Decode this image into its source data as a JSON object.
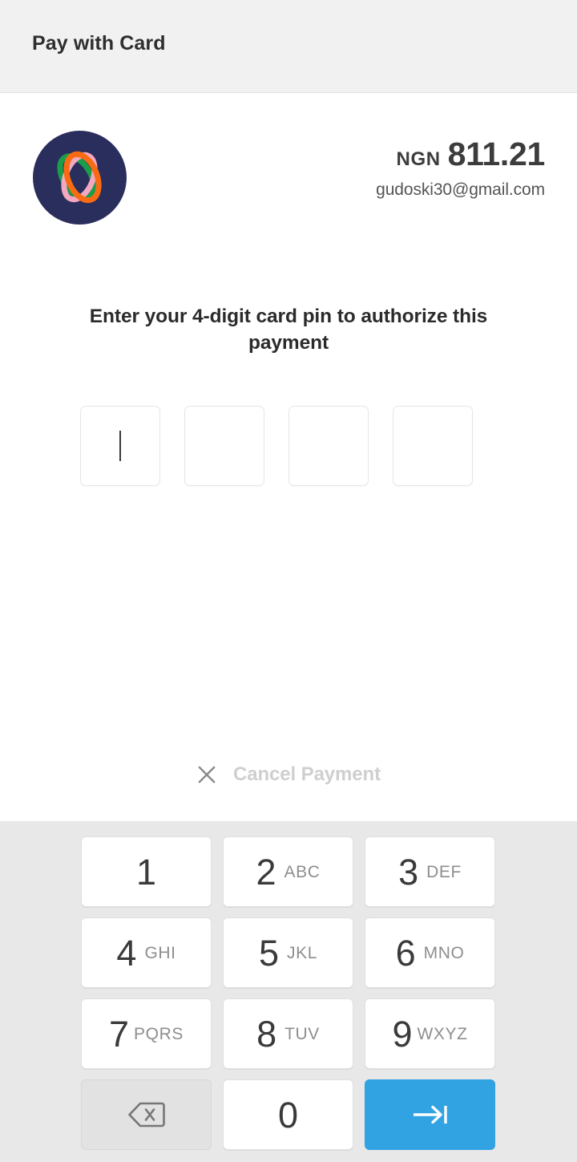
{
  "window": {
    "title": "Pay with Card"
  },
  "merchant": {
    "logo_icon": "paystack-orbit-logo-icon",
    "logo_bg_color": "#2a2e5c",
    "logo_colors": [
      "#1a9e4b",
      "#f4a7c0",
      "#f96b12"
    ]
  },
  "payment": {
    "currency": "NGN",
    "amount": "811.21",
    "email": "gudoski30@gmail.com"
  },
  "instruction": {
    "text": "Enter your 4-digit card pin to authorize this payment"
  },
  "pin": {
    "length": 4,
    "digits": [
      "",
      "",
      "",
      ""
    ],
    "active_index": 0,
    "caret_visible": true
  },
  "cancel": {
    "icon": "close-x-icon",
    "label": "Cancel Payment",
    "label_color": "#cfcfcf"
  },
  "keypad": {
    "accent_color": "#31a2e2",
    "background_color": "#e8e8e8",
    "keys": [
      {
        "id": "key-1",
        "digit": "1",
        "letters": ""
      },
      {
        "id": "key-2",
        "digit": "2",
        "letters": "ABC"
      },
      {
        "id": "key-3",
        "digit": "3",
        "letters": "DEF"
      },
      {
        "id": "key-4",
        "digit": "4",
        "letters": "GHI"
      },
      {
        "id": "key-5",
        "digit": "5",
        "letters": "JKL"
      },
      {
        "id": "key-6",
        "digit": "6",
        "letters": "MNO"
      },
      {
        "id": "key-7",
        "digit": "7",
        "letters": "PQRS"
      },
      {
        "id": "key-8",
        "digit": "8",
        "letters": "TUV"
      },
      {
        "id": "key-9",
        "digit": "9",
        "letters": "WXYZ"
      },
      {
        "id": "key-backspace",
        "digit": "",
        "letters": "",
        "icon": "backspace-delete-icon"
      },
      {
        "id": "key-0",
        "digit": "0",
        "letters": ""
      },
      {
        "id": "key-submit",
        "digit": "",
        "letters": "",
        "icon": "next-tab-arrow-icon"
      }
    ]
  }
}
